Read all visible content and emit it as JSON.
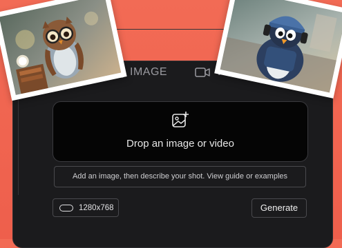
{
  "tabs": [
    {
      "label": "IMAGE",
      "icon": "image-icon"
    },
    {
      "label": "VIDEO",
      "icon": "video-camera-icon"
    }
  ],
  "dropzone": {
    "label": "Drop an image or video",
    "icon": "image-plus-icon"
  },
  "prompt": {
    "placeholder": "Add an image, then describe your shot. View guide or examples"
  },
  "size": {
    "label": "1280x768",
    "icon": "aspect-ratio-icon"
  },
  "generate": {
    "label": "Generate"
  },
  "photos": [
    {
      "subject": "owl-with-glasses-image"
    },
    {
      "subject": "penguin-with-headphones-image"
    }
  ],
  "colors": {
    "background": "#f26b55",
    "panel": "#1b1b1d",
    "dropzone": "#050505"
  }
}
